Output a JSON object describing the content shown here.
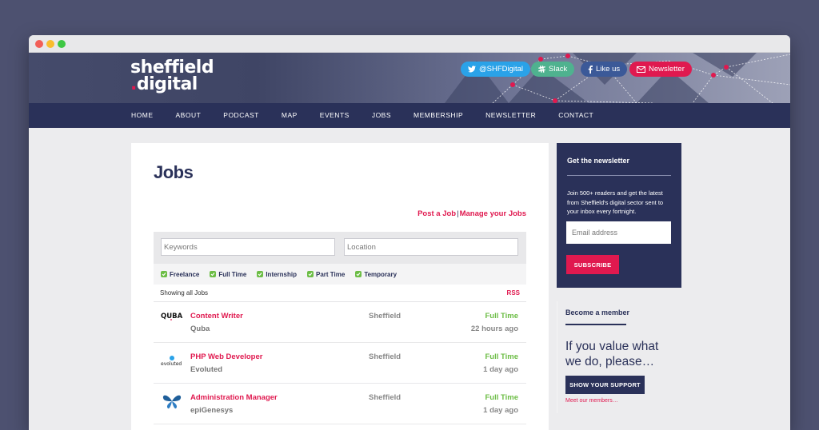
{
  "header": {
    "logo_line1": "sheffield",
    "logo_dot": ".",
    "logo_line2": "digital",
    "social": {
      "twitter": "@SHFDigital",
      "slack": "Slack",
      "facebook": "Like us",
      "newsletter": "Newsletter"
    }
  },
  "nav": [
    "HOME",
    "ABOUT",
    "PODCAST",
    "MAP",
    "EVENTS",
    "JOBS",
    "MEMBERSHIP",
    "NEWSLETTER",
    "CONTACT"
  ],
  "main": {
    "title": "Jobs",
    "post_job": "Post a Job",
    "separator": "|",
    "manage_jobs": "Manage your Jobs",
    "keywords_placeholder": "Keywords",
    "location_placeholder": "Location",
    "job_types": [
      "Freelance",
      "Full Time",
      "Internship",
      "Part Time",
      "Temporary"
    ],
    "showing": "Showing all Jobs",
    "rss": "RSS",
    "jobs": [
      {
        "title": "Content Writer",
        "company": "Quba",
        "location": "Sheffield",
        "type": "Full Time",
        "age": "22 hours ago",
        "logo": "QUBA"
      },
      {
        "title": "PHP Web Developer",
        "company": "Evoluted",
        "location": "Sheffield",
        "type": "Full Time",
        "age": "1 day ago",
        "logo": "evoluted"
      },
      {
        "title": "Administration Manager",
        "company": "epiGenesys",
        "location": "Sheffield",
        "type": "Full Time",
        "age": "1 day ago",
        "logo": "butterfly-icon"
      }
    ]
  },
  "sidebar": {
    "newsletter_title": "Get the newsletter",
    "newsletter_body": "Join 500+ readers and get the latest from Sheffield's digital sector sent to your inbox every fortnight.",
    "email_placeholder": "Email address",
    "subscribe": "SUBSCRIBE",
    "member_title": "Become a member",
    "member_pitch": "If you value what we do, please…",
    "support": "SHOW YOUR SUPPORT",
    "meet": "Meet our members…"
  },
  "colors": {
    "navy": "#2a3159",
    "accent": "#e0194f",
    "green": "#6cbd45"
  }
}
